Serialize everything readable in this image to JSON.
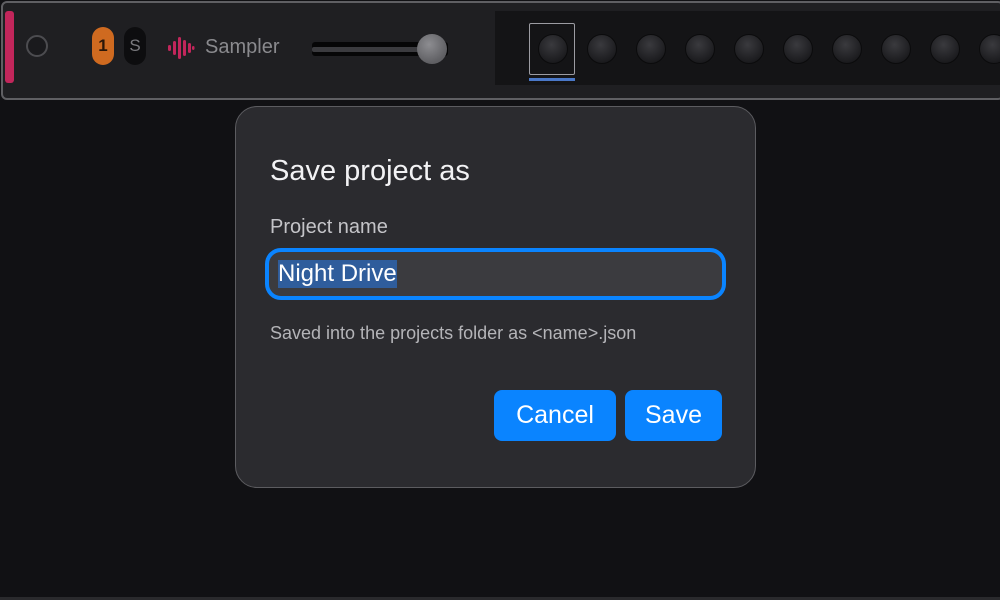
{
  "track": {
    "color": "#c2265b",
    "number": "1",
    "solo_label": "S",
    "instrument_icon": "waveform-icon",
    "instrument_name": "Sampler",
    "volume_level_percent": 88,
    "step_count": 10,
    "selected_step": 1
  },
  "dialog": {
    "title": "Save project as",
    "field_label": "Project name",
    "input_value": "Night Drive",
    "hint": "Saved into the projects folder as <name>.json",
    "cancel_label": "Cancel",
    "save_label": "Save",
    "accent_color": "#0a84ff"
  }
}
